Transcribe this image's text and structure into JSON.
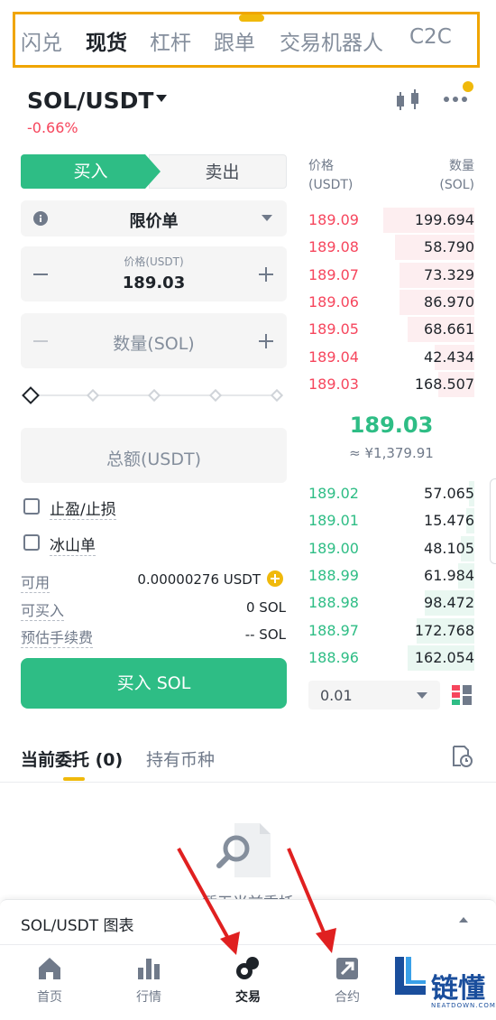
{
  "top_tabs": [
    "闪兑",
    "现货",
    "杠杆",
    "跟单",
    "交易机器人",
    "C2C"
  ],
  "top_tabs_active": "现货",
  "header": {
    "pair": "SOL/USDT",
    "change": "-0.66%"
  },
  "trade_form": {
    "buy_label": "买入",
    "sell_label": "卖出",
    "order_type": "限价单",
    "price_caption": "价格(USDT)",
    "price_value": "189.03",
    "quantity_placeholder": "数量(SOL)",
    "total_placeholder": "总额(USDT)",
    "tp_sl_label": "止盈/止损",
    "iceberg_label": "冰山单",
    "available_label": "可用",
    "available_value": "0.00000276 USDT",
    "max_buy_label": "可买入",
    "max_buy_value": "0 SOL",
    "fee_label": "预估手续费",
    "fee_value": "-- SOL",
    "submit_label": "买入 SOL",
    "slider_level": 0
  },
  "order_book": {
    "price_header": [
      "价格",
      "(USDT)"
    ],
    "qty_header": [
      "数量",
      "(SOL)"
    ],
    "asks": [
      {
        "price": "189.09",
        "qty": "199.694",
        "depth": 0.55
      },
      {
        "price": "189.08",
        "qty": "58.790",
        "depth": 0.48
      },
      {
        "price": "189.07",
        "qty": "73.329",
        "depth": 0.45
      },
      {
        "price": "189.06",
        "qty": "86.970",
        "depth": 0.45
      },
      {
        "price": "189.05",
        "qty": "68.661",
        "depth": 0.4
      },
      {
        "price": "189.04",
        "qty": "42.434",
        "depth": 0.24
      },
      {
        "price": "189.03",
        "qty": "168.507",
        "depth": 0.22
      }
    ],
    "last_price": "189.03",
    "fiat_price": "≈ ¥1,379.91",
    "bids": [
      {
        "price": "189.02",
        "qty": "57.065",
        "depth": 0.03
      },
      {
        "price": "189.01",
        "qty": "15.476",
        "depth": 0.05
      },
      {
        "price": "189.00",
        "qty": "48.105",
        "depth": 0.08
      },
      {
        "price": "188.99",
        "qty": "61.984",
        "depth": 0.1
      },
      {
        "price": "188.98",
        "qty": "98.472",
        "depth": 0.3
      },
      {
        "price": "188.97",
        "qty": "172.768",
        "depth": 0.35
      },
      {
        "price": "188.96",
        "qty": "162.054",
        "depth": 0.4
      }
    ],
    "depth_step": "0.01"
  },
  "orders": {
    "tab_open": "当前委托 (0)",
    "tab_holdings": "持有币种",
    "empty_text": "暂无当前委托"
  },
  "chart_bar": {
    "label": "SOL/USDT 图表"
  },
  "bottom_nav": {
    "home": "首页",
    "markets": "行情",
    "trade": "交易",
    "futures": "合约"
  },
  "watermark": {
    "text": "链懂",
    "sub": "NEATDOWN.COM"
  },
  "colors": {
    "buy_green": "#2ebd85",
    "sell_red": "#f6465d",
    "accent_yellow": "#f0b90b",
    "highlight_box": "#f0a500",
    "annotation_arrow": "#e02020"
  }
}
